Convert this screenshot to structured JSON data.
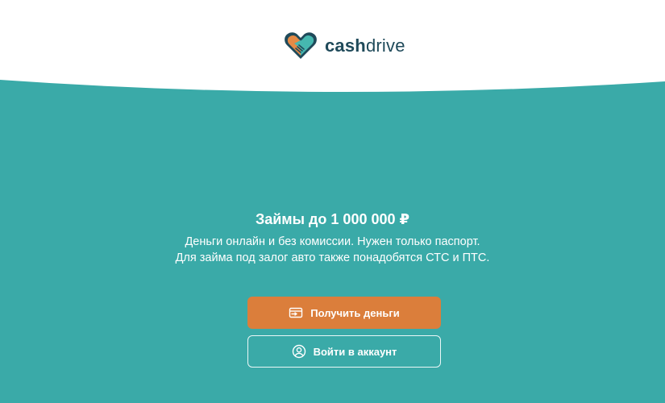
{
  "header": {
    "logo_bold": "cash",
    "logo_light": "drive",
    "logo_icon": "handshake-heart-icon"
  },
  "hero": {
    "title": "Займы до 1 000 000 ₽",
    "subtitle_line1": "Деньги онлайн и без комиссии. Нужен только паспорт.",
    "subtitle_line2": "Для займа под залог авто также понадобятся СТС и ПТС."
  },
  "actions": {
    "get_money_label": "Получить деньги",
    "get_money_icon": "money-transfer-icon",
    "login_label": "Войти в аккаунт",
    "login_icon": "user-circle-icon"
  },
  "colors": {
    "background_teal": "#3aaaa8",
    "primary_orange": "#db7e3b",
    "logo_dark": "#1f4a5a"
  }
}
